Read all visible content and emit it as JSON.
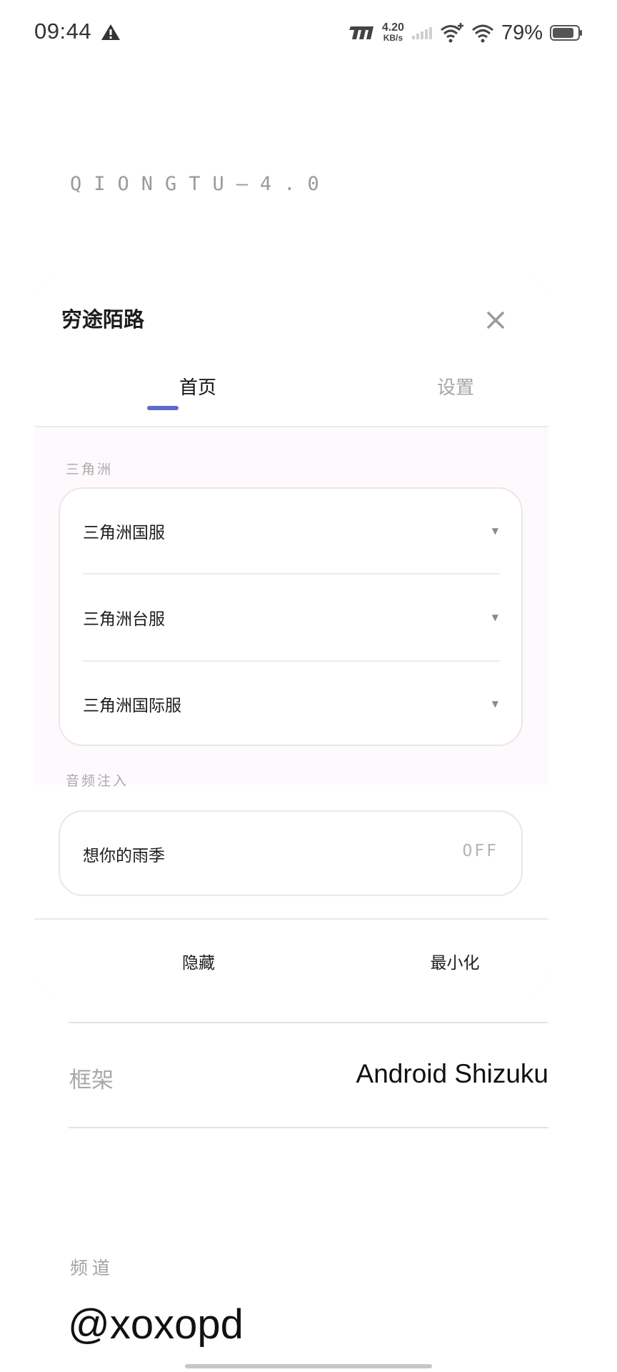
{
  "status_bar": {
    "time": "09:44",
    "net_speed_value": "4.20",
    "net_speed_unit": "KB/s",
    "battery": "79%",
    "icons": [
      "warning-icon",
      "hd-icon",
      "signal-icon",
      "wifi-calling-icon",
      "wifi-icon",
      "battery-icon"
    ]
  },
  "app": {
    "title": "QIONGTU—4.0",
    "framework_label": "框架",
    "framework_value": "Android Shizuku",
    "channel_label": "频道",
    "channel_value": "@xoxopd"
  },
  "dialog": {
    "title": "穷途陌路",
    "close_icon": "close-icon",
    "tabs": [
      {
        "label": "首页",
        "active": true
      },
      {
        "label": "设置",
        "active": false
      }
    ],
    "sections": [
      {
        "label": "三角洲",
        "items": [
          {
            "label": "三角洲国服",
            "arrow": "▼"
          },
          {
            "label": "三角洲台服",
            "arrow": "▼"
          },
          {
            "label": "三角洲国际服",
            "arrow": "▼"
          }
        ]
      },
      {
        "label": "音频注入",
        "items": [
          {
            "label": "想你的雨季",
            "state": "OFF"
          }
        ]
      }
    ],
    "footer": {
      "hide_label": "隐藏",
      "minimize_label": "最小化"
    }
  },
  "colors": {
    "accent": "#5d6ac9",
    "body_tint": "#fdf9fd",
    "muted_text": "#a5a5a5"
  }
}
